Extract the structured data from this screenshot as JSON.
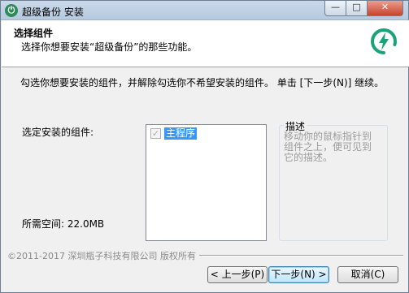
{
  "window": {
    "title": "超级备份 安装",
    "app_icon": "power-icon",
    "controls": {
      "minimize": "—",
      "maximize": "□",
      "close": "✕"
    }
  },
  "header": {
    "title": "选择组件",
    "subtitle": "选择你想要安装“超级备份”的那些功能。",
    "logo_icon": "power-logo-icon",
    "logo_color": "#1aa37a"
  },
  "body": {
    "instruction": "勾选你想要安装的组件，并解除勾选你不希望安装的组件。 单击 [下一步(N)] 继续。",
    "select_label": "选定安装的组件:",
    "space_label": "所需空间: 22.0MB",
    "components": [
      {
        "label": "主程序",
        "checked": true,
        "disabled": true
      }
    ],
    "description": {
      "title": "描述",
      "text": "移动你的鼠标指针到组件之上，便可见到它的描述。"
    }
  },
  "footer": {
    "brand": "©2011-2017 深圳瓶子科技有限公司 版权所有",
    "back_label": "< 上一步(P)",
    "next_label": "下一步(N) >",
    "cancel_label": "取消(C)"
  }
}
